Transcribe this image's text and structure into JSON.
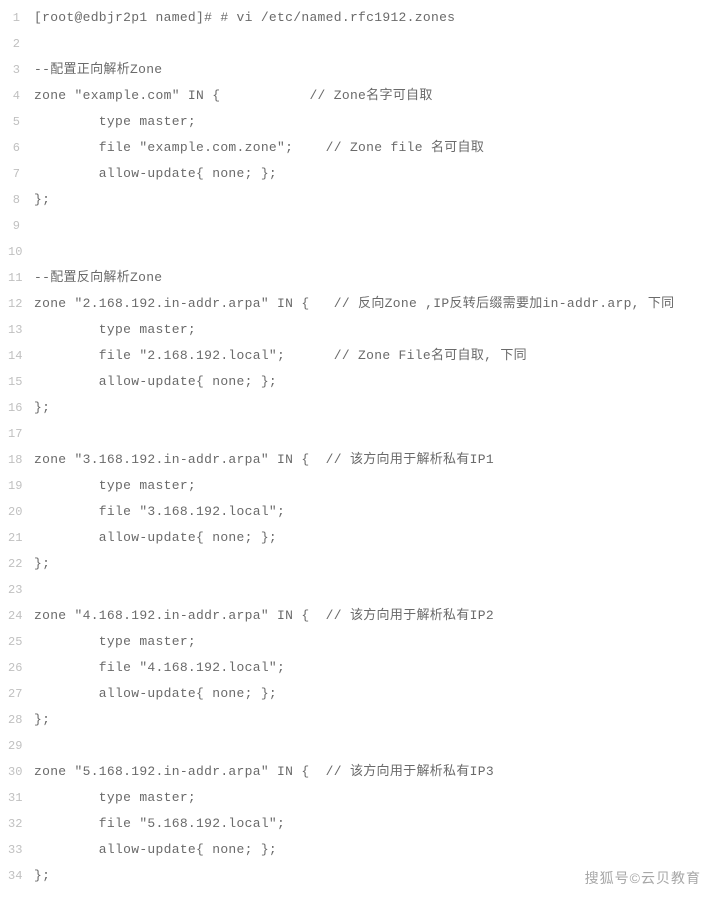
{
  "code": {
    "lines": [
      {
        "num": "1",
        "text": "[root@edbjr2p1 named]# # vi /etc/named.rfc1912.zones"
      },
      {
        "num": "2",
        "text": ""
      },
      {
        "num": "3",
        "text": "--配置正向解析Zone"
      },
      {
        "num": "4",
        "text": "zone \"example.com\" IN {           // Zone名字可自取"
      },
      {
        "num": "5",
        "text": "        type master;"
      },
      {
        "num": "6",
        "text": "        file \"example.com.zone\";    // Zone file 名可自取"
      },
      {
        "num": "7",
        "text": "        allow-update{ none; };"
      },
      {
        "num": "8",
        "text": "};"
      },
      {
        "num": "9",
        "text": ""
      },
      {
        "num": "10",
        "text": ""
      },
      {
        "num": "11",
        "text": "--配置反向解析Zone"
      },
      {
        "num": "12",
        "text": "zone \"2.168.192.in-addr.arpa\" IN {   // 反向Zone ,IP反转后缀需要加in-addr.arp, 下同"
      },
      {
        "num": "13",
        "text": "        type master;"
      },
      {
        "num": "14",
        "text": "        file \"2.168.192.local\";      // Zone File名可自取, 下同"
      },
      {
        "num": "15",
        "text": "        allow-update{ none; };"
      },
      {
        "num": "16",
        "text": "};"
      },
      {
        "num": "17",
        "text": ""
      },
      {
        "num": "18",
        "text": "zone \"3.168.192.in-addr.arpa\" IN {  // 该方向用于解析私有IP1"
      },
      {
        "num": "19",
        "text": "        type master;"
      },
      {
        "num": "20",
        "text": "        file \"3.168.192.local\";"
      },
      {
        "num": "21",
        "text": "        allow-update{ none; };"
      },
      {
        "num": "22",
        "text": "};"
      },
      {
        "num": "23",
        "text": ""
      },
      {
        "num": "24",
        "text": "zone \"4.168.192.in-addr.arpa\" IN {  // 该方向用于解析私有IP2"
      },
      {
        "num": "25",
        "text": "        type master;"
      },
      {
        "num": "26",
        "text": "        file \"4.168.192.local\";"
      },
      {
        "num": "27",
        "text": "        allow-update{ none; };"
      },
      {
        "num": "28",
        "text": "};"
      },
      {
        "num": "29",
        "text": ""
      },
      {
        "num": "30",
        "text": "zone \"5.168.192.in-addr.arpa\" IN {  // 该方向用于解析私有IP3"
      },
      {
        "num": "31",
        "text": "        type master;"
      },
      {
        "num": "32",
        "text": "        file \"5.168.192.local\";"
      },
      {
        "num": "33",
        "text": "        allow-update{ none; };"
      },
      {
        "num": "34",
        "text": "};"
      }
    ]
  },
  "watermark": "搜狐号©云贝教育"
}
